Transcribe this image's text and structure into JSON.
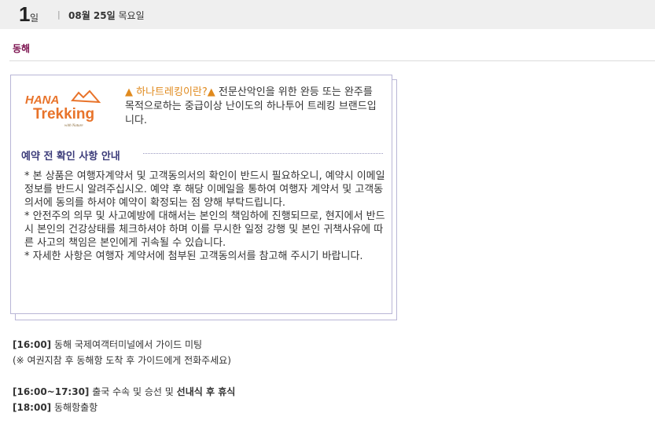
{
  "header": {
    "day_number": "1",
    "day_unit": "일",
    "separator": "|",
    "date_bold": "08월 25일",
    "weekday": "목요일"
  },
  "city": "동해",
  "logo": {
    "brand_top": "HANA",
    "brand_bottom": "Trekking",
    "tagline": "with Nature"
  },
  "intro": {
    "highlight": "하나트레킹이란?",
    "triangle": "▲",
    "text": "전문산악인을 위한 완등 또는 완주를 목적으로하는 중급이상 난이도의 하나투어 트레킹 브랜드입니다."
  },
  "notice": {
    "title": "예약 전 확인 사항 안내",
    "paragraphs": [
      "* 본 상품은 여행자계약서 및 고객동의서의 확인이 반드시 필요하오니, 예약시 이메일 정보를 반드시 알려주십시오. 예약 후 해당 이메일을 통하여 여행자 계약서 및 고객동의서에 동의를 하셔야 예약이 확정되는 점 양해 부탁드립니다.",
      "* 안전주의 의무 및 사고예방에 대해서는 본인의 책임하에 진행되므로, 현지에서 반드시 본인의 건강상태를 체크하셔야 하며 이를 무시한 일정 강행 및 본인 귀책사유에 따른 사고의 책임은 본인에게 귀속될 수 있습니다.",
      "* 자세한 사항은 여행자 계약서에 첨부된 고객동의서를 참고해 주시기 바랍니다."
    ]
  },
  "schedule": [
    {
      "time": "[16:00]",
      "text": "동해 국제여객터미널에서 가이드 미팅",
      "strong": ""
    },
    {
      "time": "",
      "text": "(※ 여권지참 후 동해항 도착 후 가이드에게 전화주세요)",
      "strong": ""
    },
    {
      "time": "[16:00~17:30]",
      "text": "출국 수속 및 승선 및",
      "strong": "선내식 후 휴식"
    },
    {
      "time": "[18:00]",
      "text": "동해항출항",
      "strong": ""
    }
  ]
}
